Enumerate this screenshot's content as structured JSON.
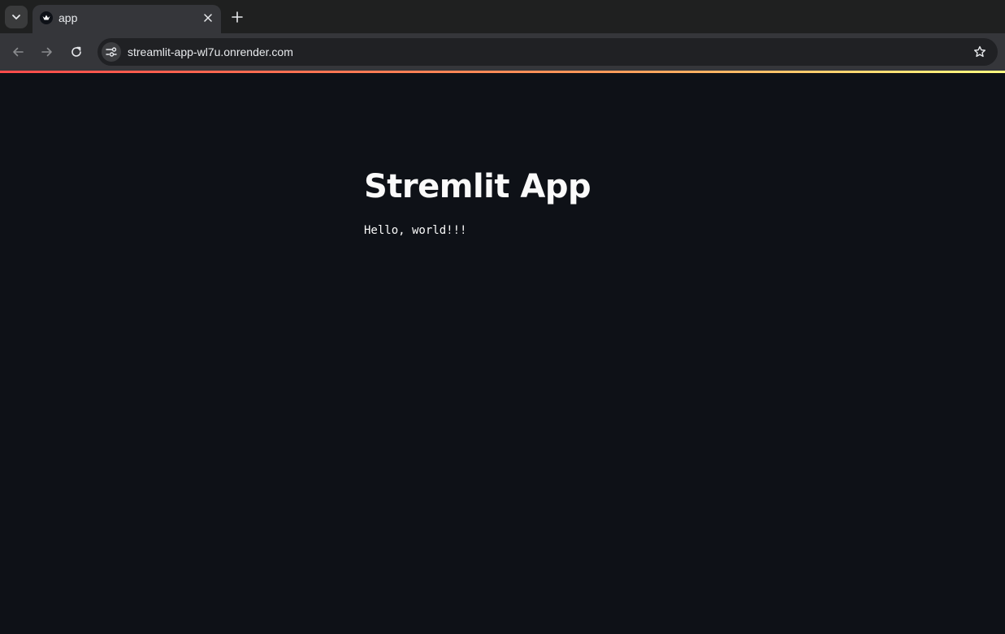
{
  "tab": {
    "title": "app",
    "favicon": "streamlit-crown-icon"
  },
  "toolbar": {
    "url": "streamlit-app-wl7u.onrender.com"
  },
  "app": {
    "title": "Stremlit App",
    "text": "Hello, world!!!"
  },
  "colors": {
    "background": "#0e1117",
    "text": "#fafafa",
    "accent_gradient": [
      "#ff4b4b",
      "#fffd80"
    ]
  }
}
